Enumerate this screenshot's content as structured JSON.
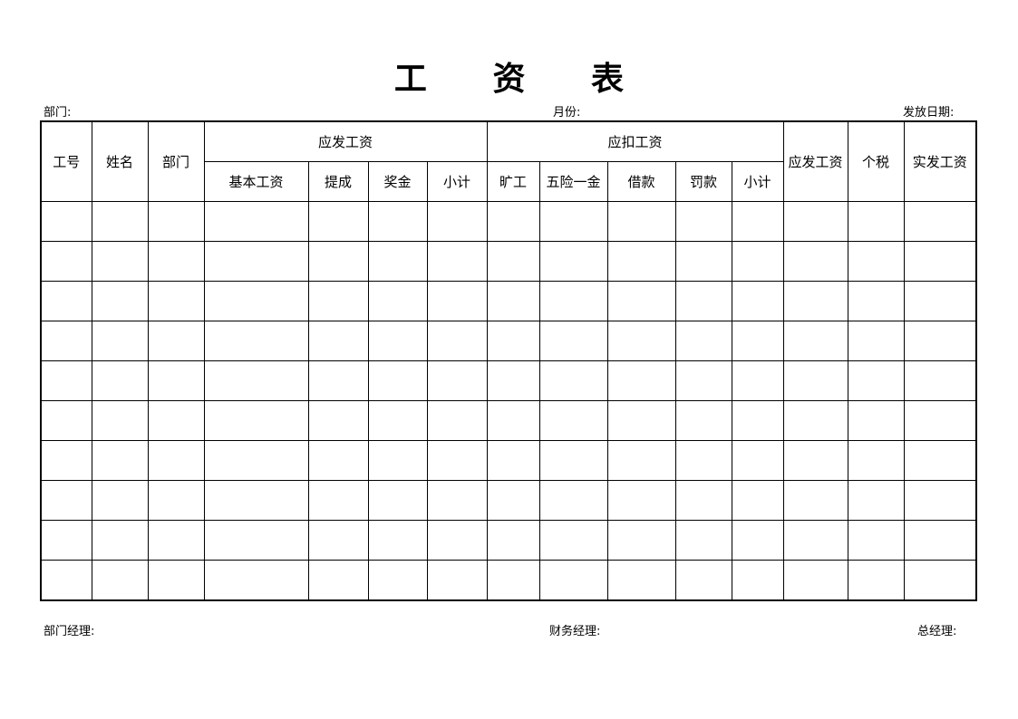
{
  "title_chars": [
    "工",
    "资",
    "表"
  ],
  "meta": {
    "department_label": "部门:",
    "month_label": "月份:",
    "pay_date_label": "发放日期:"
  },
  "table": {
    "columns": {
      "employee_id": "工号",
      "name": "姓名",
      "department": "部门",
      "payable_group": "应发工资",
      "base_salary": "基本工资",
      "commission": "提成",
      "bonus": "奖金",
      "payable_subtotal": "小计",
      "deduction_group": "应扣工资",
      "absence": "旷工",
      "social_insurance": "五险一金",
      "loan": "借款",
      "fine": "罚款",
      "deduction_subtotal": "小计",
      "gross_pay": "应发工资",
      "income_tax": "个税",
      "net_pay": "实发工资"
    },
    "rows": [
      [
        "",
        "",
        "",
        "",
        "",
        "",
        "",
        "",
        "",
        "",
        "",
        "",
        "",
        "",
        ""
      ],
      [
        "",
        "",
        "",
        "",
        "",
        "",
        "",
        "",
        "",
        "",
        "",
        "",
        "",
        "",
        ""
      ],
      [
        "",
        "",
        "",
        "",
        "",
        "",
        "",
        "",
        "",
        "",
        "",
        "",
        "",
        "",
        ""
      ],
      [
        "",
        "",
        "",
        "",
        "",
        "",
        "",
        "",
        "",
        "",
        "",
        "",
        "",
        "",
        ""
      ],
      [
        "",
        "",
        "",
        "",
        "",
        "",
        "",
        "",
        "",
        "",
        "",
        "",
        "",
        "",
        ""
      ],
      [
        "",
        "",
        "",
        "",
        "",
        "",
        "",
        "",
        "",
        "",
        "",
        "",
        "",
        "",
        ""
      ],
      [
        "",
        "",
        "",
        "",
        "",
        "",
        "",
        "",
        "",
        "",
        "",
        "",
        "",
        "",
        ""
      ],
      [
        "",
        "",
        "",
        "",
        "",
        "",
        "",
        "",
        "",
        "",
        "",
        "",
        "",
        "",
        ""
      ],
      [
        "",
        "",
        "",
        "",
        "",
        "",
        "",
        "",
        "",
        "",
        "",
        "",
        "",
        "",
        ""
      ],
      [
        "",
        "",
        "",
        "",
        "",
        "",
        "",
        "",
        "",
        "",
        "",
        "",
        "",
        "",
        ""
      ]
    ]
  },
  "footer": {
    "dept_manager_label": "部门经理:",
    "finance_manager_label": "财务经理:",
    "general_manager_label": "总经理:"
  }
}
